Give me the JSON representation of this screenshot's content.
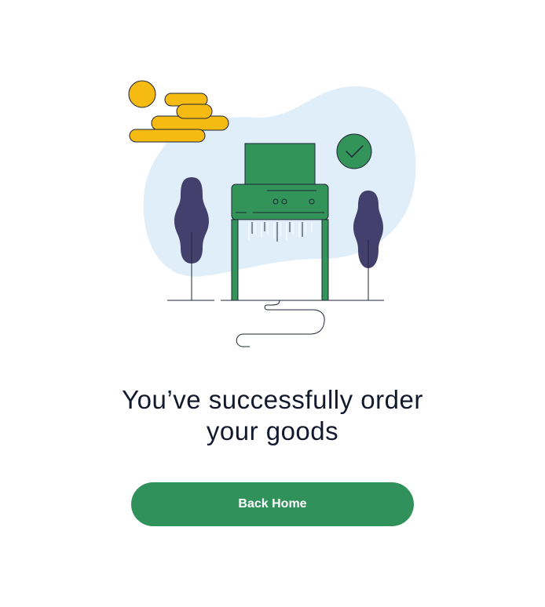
{
  "illustration": {
    "icon": "paper-shredder-illustration",
    "colors": {
      "blob": "#dfeef8",
      "sun": "#f6bb12",
      "shredder": "#33945a",
      "tree": "#44406d",
      "outline": "#1f2537"
    }
  },
  "message": {
    "line1": "You’ve successfully order",
    "line2": "your goods"
  },
  "actions": {
    "back_home_label": "Back Home",
    "accent": "#31915a"
  }
}
